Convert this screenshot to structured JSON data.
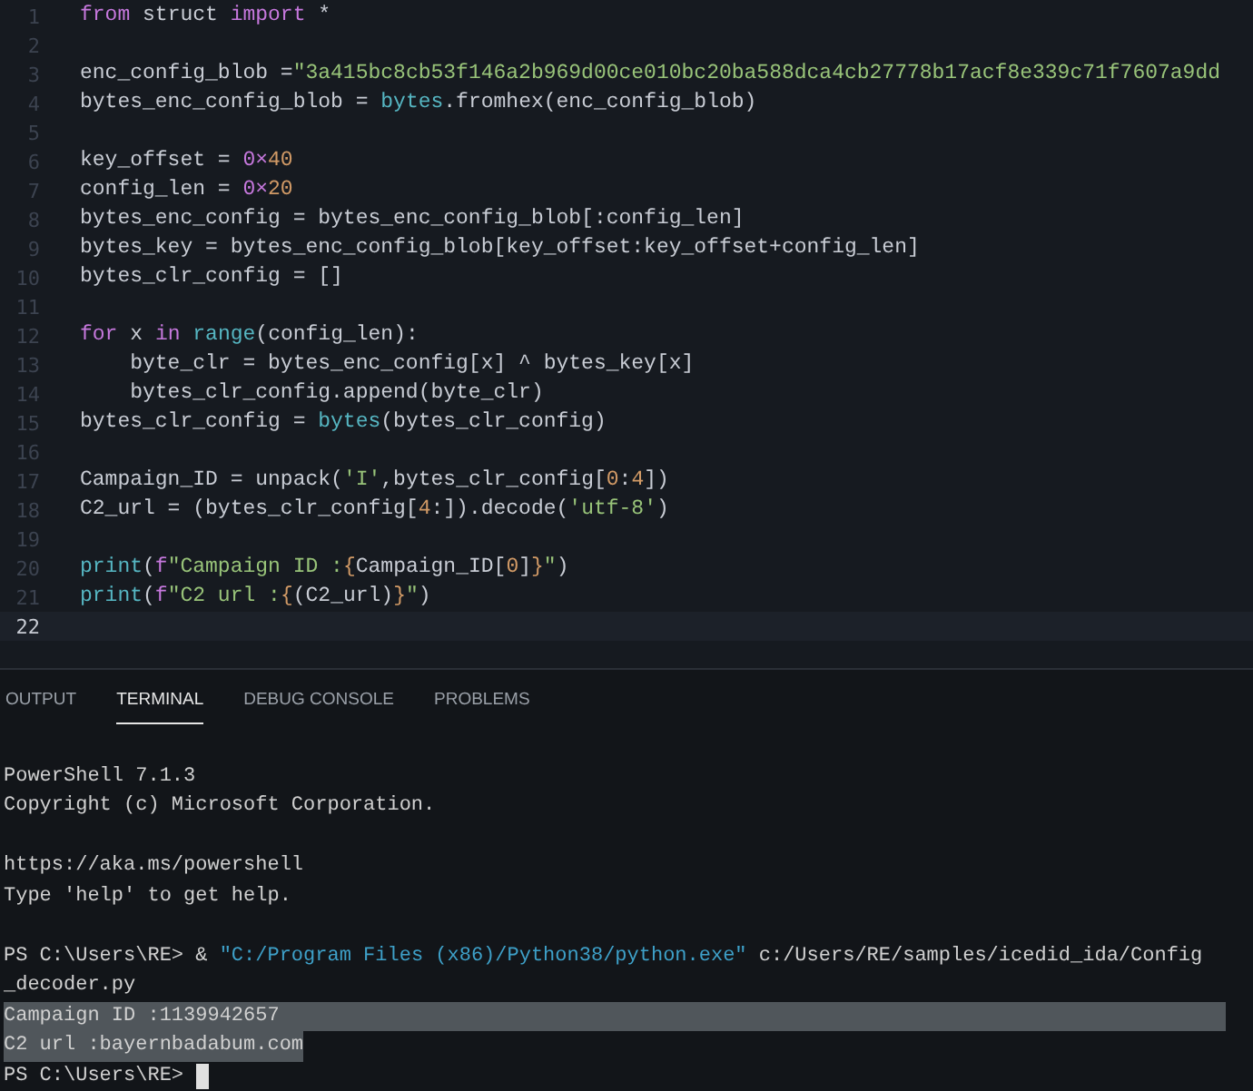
{
  "editor": {
    "lines": [
      {
        "number": "1",
        "active": false,
        "tokens": [
          {
            "kind": "keyword",
            "text": "from"
          },
          {
            "kind": "plain",
            "text": " struct "
          },
          {
            "kind": "keyword",
            "text": "import"
          },
          {
            "kind": "plain",
            "text": " *"
          }
        ]
      },
      {
        "number": "2",
        "active": false
      },
      {
        "number": "3",
        "active": false,
        "tokens": [
          {
            "kind": "plain",
            "text": "enc_config_blob ="
          },
          {
            "kind": "string",
            "text": "\"3a415bc8cb53f146a2b969d00ce010bc20ba588dca4cb27778b17acf8e339c71f7607a9dd"
          }
        ]
      },
      {
        "number": "4",
        "active": false,
        "tokens": [
          {
            "kind": "plain",
            "text": "bytes_enc_config_blob = "
          },
          {
            "kind": "builtin",
            "text": "bytes"
          },
          {
            "kind": "plain",
            "text": ".fromhex(enc_config_blob)"
          }
        ]
      },
      {
        "number": "5",
        "active": false
      },
      {
        "number": "6",
        "active": false,
        "tokens": [
          {
            "kind": "plain",
            "text": "key_offset = "
          },
          {
            "kind": "keyword",
            "text": "0×"
          },
          {
            "kind": "number",
            "text": "40"
          }
        ]
      },
      {
        "number": "7",
        "active": false,
        "tokens": [
          {
            "kind": "plain",
            "text": "config_len = "
          },
          {
            "kind": "keyword",
            "text": "0×"
          },
          {
            "kind": "number",
            "text": "20"
          }
        ]
      },
      {
        "number": "8",
        "active": false,
        "tokens": [
          {
            "kind": "plain",
            "text": "bytes_enc_config = bytes_enc_config_blob[:config_len]"
          }
        ]
      },
      {
        "number": "9",
        "active": false,
        "tokens": [
          {
            "kind": "plain",
            "text": "bytes_key = bytes_enc_config_blob[key_offset:key_offset+config_len]"
          }
        ]
      },
      {
        "number": "10",
        "active": false,
        "tokens": [
          {
            "kind": "plain",
            "text": "bytes_clr_config = []"
          }
        ]
      },
      {
        "number": "11",
        "active": false
      },
      {
        "number": "12",
        "active": false,
        "tokens": [
          {
            "kind": "keyword",
            "text": "for"
          },
          {
            "kind": "plain",
            "text": " x "
          },
          {
            "kind": "keyword",
            "text": "in"
          },
          {
            "kind": "builtin",
            "text": " range"
          },
          {
            "kind": "plain",
            "text": "(config_len):"
          }
        ]
      },
      {
        "number": "13",
        "active": false,
        "tokens": [
          {
            "kind": "plain",
            "text": "    byte_clr = bytes_enc_config[x] ^ bytes_key[x]"
          }
        ]
      },
      {
        "number": "14",
        "active": false,
        "tokens": [
          {
            "kind": "plain",
            "text": "    bytes_clr_config.append(byte_clr)"
          }
        ]
      },
      {
        "number": "15",
        "active": false,
        "tokens": [
          {
            "kind": "plain",
            "text": "bytes_clr_config = "
          },
          {
            "kind": "builtin",
            "text": "bytes"
          },
          {
            "kind": "plain",
            "text": "(bytes_clr_config)"
          }
        ]
      },
      {
        "number": "16",
        "active": false
      },
      {
        "number": "17",
        "active": false,
        "tokens": [
          {
            "kind": "plain",
            "text": "Campaign_ID = unpack("
          },
          {
            "kind": "string",
            "text": "'I'"
          },
          {
            "kind": "plain",
            "text": ",bytes_clr_config["
          },
          {
            "kind": "number",
            "text": "0"
          },
          {
            "kind": "plain",
            "text": ":"
          },
          {
            "kind": "number",
            "text": "4"
          },
          {
            "kind": "plain",
            "text": "])"
          }
        ]
      },
      {
        "number": "18",
        "active": false,
        "tokens": [
          {
            "kind": "plain",
            "text": "C2_url = (bytes_clr_config["
          },
          {
            "kind": "number",
            "text": "4"
          },
          {
            "kind": "plain",
            "text": ":]).decode("
          },
          {
            "kind": "string",
            "text": "'utf-8'"
          },
          {
            "kind": "plain",
            "text": ")"
          }
        ]
      },
      {
        "number": "19",
        "active": false
      },
      {
        "number": "20",
        "active": false,
        "tokens": [
          {
            "kind": "builtin",
            "text": "print"
          },
          {
            "kind": "plain",
            "text": "("
          },
          {
            "kind": "keyword",
            "text": "f"
          },
          {
            "kind": "string",
            "text": "\"Campaign ID :"
          },
          {
            "kind": "number",
            "text": "{"
          },
          {
            "kind": "plain",
            "text": "Campaign_ID["
          },
          {
            "kind": "number",
            "text": "0"
          },
          {
            "kind": "plain",
            "text": "]"
          },
          {
            "kind": "number",
            "text": "}"
          },
          {
            "kind": "string",
            "text": "\""
          },
          {
            "kind": "plain",
            "text": ")"
          }
        ]
      },
      {
        "number": "21",
        "active": false,
        "tokens": [
          {
            "kind": "builtin",
            "text": "print"
          },
          {
            "kind": "plain",
            "text": "("
          },
          {
            "kind": "keyword",
            "text": "f"
          },
          {
            "kind": "string",
            "text": "\"C2 url :"
          },
          {
            "kind": "number",
            "text": "{"
          },
          {
            "kind": "plain",
            "text": "(C2_url)"
          },
          {
            "kind": "number",
            "text": "}"
          },
          {
            "kind": "string",
            "text": "\""
          },
          {
            "kind": "plain",
            "text": ")"
          }
        ]
      },
      {
        "number": "22",
        "active": true
      }
    ]
  },
  "panel": {
    "tabs": [
      {
        "label": "OUTPUT",
        "selected": false
      },
      {
        "label": "TERMINAL",
        "selected": true
      },
      {
        "label": "DEBUG CONSOLE",
        "selected": false
      },
      {
        "label": "PROBLEMS",
        "selected": false
      }
    ],
    "terminal": [
      {
        "kind": "blank"
      },
      {
        "kind": "text",
        "segments": [
          {
            "kind": "plain",
            "text": "PowerShell 7.1.3"
          }
        ],
        "selected": false
      },
      {
        "kind": "text",
        "segments": [
          {
            "kind": "plain",
            "text": "Copyright (c) Microsoft Corporation."
          }
        ],
        "selected": false
      },
      {
        "kind": "blank"
      },
      {
        "kind": "text",
        "segments": [
          {
            "kind": "plain",
            "text": "https://aka.ms/powershell"
          }
        ],
        "selected": false
      },
      {
        "kind": "text",
        "segments": [
          {
            "kind": "plain",
            "text": "Type 'help' to get help."
          }
        ],
        "selected": false
      },
      {
        "kind": "blank"
      },
      {
        "kind": "text",
        "segments": [
          {
            "kind": "plain",
            "text": "PS C:\\Users\\RE> & "
          },
          {
            "kind": "string",
            "text": "\"C:/Program Files (x86)/Python38/python.exe\""
          },
          {
            "kind": "plain",
            "text": " c:/Users/RE/samples/icedid_ida/Config"
          }
        ],
        "selected": false
      },
      {
        "kind": "text",
        "segments": [
          {
            "kind": "plain",
            "text": "_decoder.py"
          }
        ],
        "selected": false
      },
      {
        "kind": "text",
        "segments": [
          {
            "kind": "plain",
            "text": "Campaign ID :1139942657"
          }
        ],
        "selected": true
      },
      {
        "kind": "text",
        "segments": [
          {
            "kind": "plain",
            "text": "C2 url :bayernbadabum.com"
          }
        ],
        "selected": true
      },
      {
        "kind": "text",
        "segments": [
          {
            "kind": "plain",
            "text": "PS C:\\Users\\RE> "
          }
        ],
        "selected": false,
        "cursor": true
      }
    ]
  }
}
